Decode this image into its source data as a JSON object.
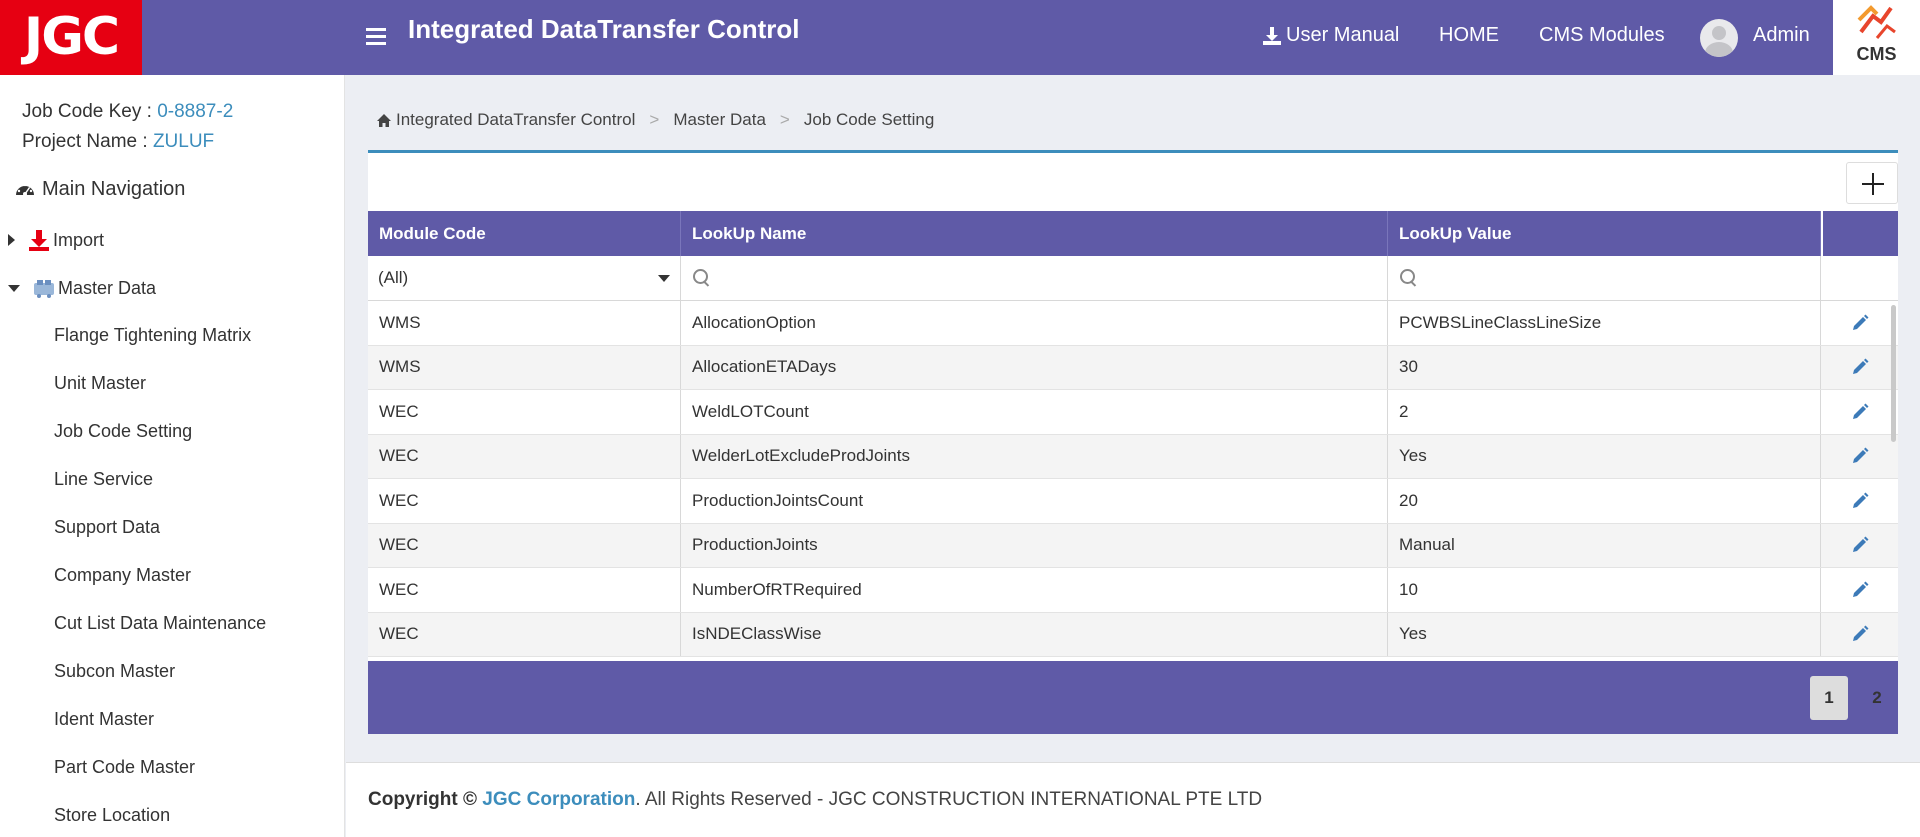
{
  "header": {
    "logo_text": "JGC",
    "title": "Integrated DataTransfer Control",
    "user_manual": "User Manual",
    "home": "HOME",
    "cms_modules": "CMS Modules",
    "admin": "Admin",
    "cms_logo_text": "CMS",
    "accent_color": "#5f5aa7",
    "brand_red": "#e60012"
  },
  "sidebar": {
    "job_code_label": "Job Code Key : ",
    "job_code_value": "0-8887-2",
    "project_label": "Project Name : ",
    "project_value": "ZULUF",
    "main_navigation": "Main Navigation",
    "import_label": "Import",
    "master_data_label": "Master Data",
    "items": [
      "Flange Tightening Matrix",
      "Unit Master",
      "Job Code Setting",
      "Line Service",
      "Support Data",
      "Company Master",
      "Cut List Data Maintenance",
      "Subcon Master",
      "Ident Master",
      "Part Code Master",
      "Store Location"
    ]
  },
  "breadcrumb": {
    "root": "Integrated DataTransfer Control",
    "level1": "Master Data",
    "current": "Job Code Setting",
    "separator": ">"
  },
  "grid": {
    "columns": [
      "Module Code",
      "LookUp Name",
      "LookUp Value"
    ],
    "filter_module_value": "(All)",
    "rows": [
      {
        "module": "WMS",
        "name": "AllocationOption",
        "value": "PCWBSLineClassLineSize"
      },
      {
        "module": "WMS",
        "name": "AllocationETADays",
        "value": "30"
      },
      {
        "module": "WEC",
        "name": "WeldLOTCount",
        "value": "2"
      },
      {
        "module": "WEC",
        "name": "WelderLotExcludeProdJoints",
        "value": "Yes"
      },
      {
        "module": "WEC",
        "name": "ProductionJointsCount",
        "value": "20"
      },
      {
        "module": "WEC",
        "name": "ProductionJoints",
        "value": "Manual"
      },
      {
        "module": "WEC",
        "name": "NumberOfRTRequired",
        "value": "10"
      },
      {
        "module": "WEC",
        "name": "IsNDEClassWise",
        "value": "Yes"
      }
    ],
    "pages": [
      "1",
      "2"
    ],
    "current_page": "1"
  },
  "footer": {
    "copyright": "Copyright ©",
    "corp": "JGC Corporation",
    "rest": ". All Rights Reserved - JGC CONSTRUCTION INTERNATIONAL PTE LTD"
  }
}
